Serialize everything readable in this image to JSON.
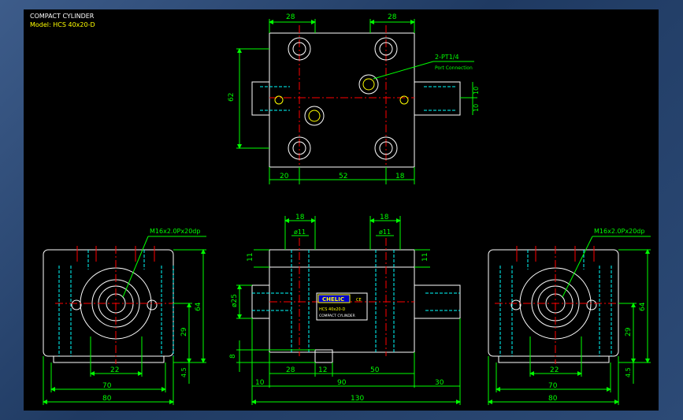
{
  "title": {
    "line1": "COMPACT CYLINDER",
    "line2": "Model: HCS 40x20-D"
  },
  "colors": {
    "background": "#000000",
    "outline": "#ffffff",
    "dimension": "#00ff00",
    "hidden": "#00ffff",
    "center": "#ff0000",
    "accent": "#ffff00",
    "frame": "#2b4266"
  },
  "top_view": {
    "dims": {
      "top_left": "28",
      "top_right": "28",
      "left_height": "62",
      "right_a": "10",
      "right_b": "10",
      "bottom_left": "20",
      "bottom_mid": "52",
      "bottom_right": "18"
    },
    "port_label": "2-PT1/4",
    "port_sub": "Port Connection"
  },
  "left_view": {
    "thread": "M16x2.0Px20dp",
    "dims": {
      "d22": "22",
      "d70": "70",
      "d80": "80",
      "h64": "64",
      "h29": "29",
      "h45": "4.5"
    }
  },
  "front_view": {
    "dims": {
      "t18a": "18",
      "t18b": "18",
      "phi11a": "ø11",
      "phi11b": "ø11",
      "h11a": "11",
      "h11b": "11",
      "phi25": "ø25",
      "h8": "8",
      "d28": "28",
      "d12": "12",
      "d50": "50",
      "d10": "10",
      "d90": "90",
      "d30": "30",
      "d130": "130"
    },
    "label": {
      "brand": "CHELIC",
      "code": "CE",
      "model": "HCS 40x20-D",
      "name": "COMPACT CYLINDER"
    }
  },
  "right_view": {
    "thread": "M16x2.0Px20dp",
    "dims": {
      "d22": "22",
      "d70": "70",
      "d80": "80",
      "h64": "64",
      "h29": "29",
      "h45": "4.5"
    }
  }
}
